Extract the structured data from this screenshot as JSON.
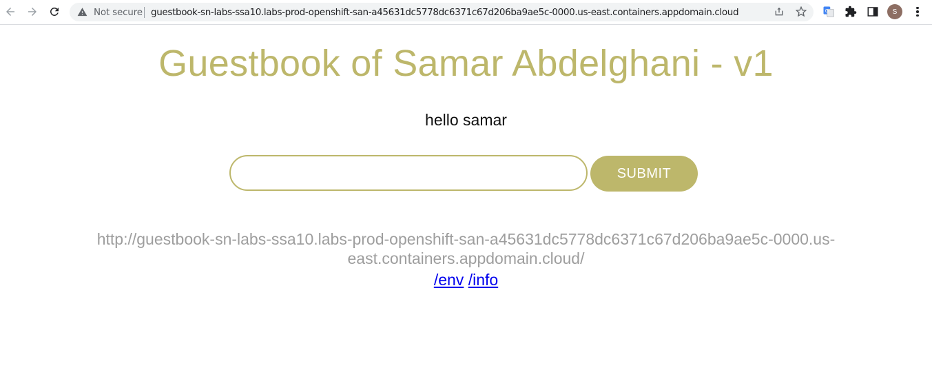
{
  "browser": {
    "security_label": "Not secure",
    "url": "guestbook-sn-labs-ssa10.labs-prod-openshift-san-a45631dc5778dc6371c67d206ba9ae5c-0000.us-east.containers.appdomain.cloud",
    "profile_initial": "S",
    "icons": [
      "back-icon",
      "forward-icon",
      "reload-icon",
      "warning-icon",
      "share-icon",
      "star-icon",
      "translate-icon",
      "puzzle-icon",
      "side-panel-icon",
      "menu-icon"
    ]
  },
  "page": {
    "title": "Guestbook of Samar Abdelghani - v1",
    "message": "hello samar",
    "input": {
      "value": "",
      "placeholder": ""
    },
    "submit_label": "SUBMIT",
    "host_line": "http://guestbook-sn-labs-ssa10.labs-prod-openshift-san-a45631dc5778dc6371c67d206ba9ae5c-0000.us-east.containers.appdomain.cloud/",
    "links": {
      "env": "/env",
      "info": "/info"
    }
  },
  "colors": {
    "accent": "#bdb76b",
    "host_text": "#9e9e9e",
    "link": "#0000ee"
  }
}
